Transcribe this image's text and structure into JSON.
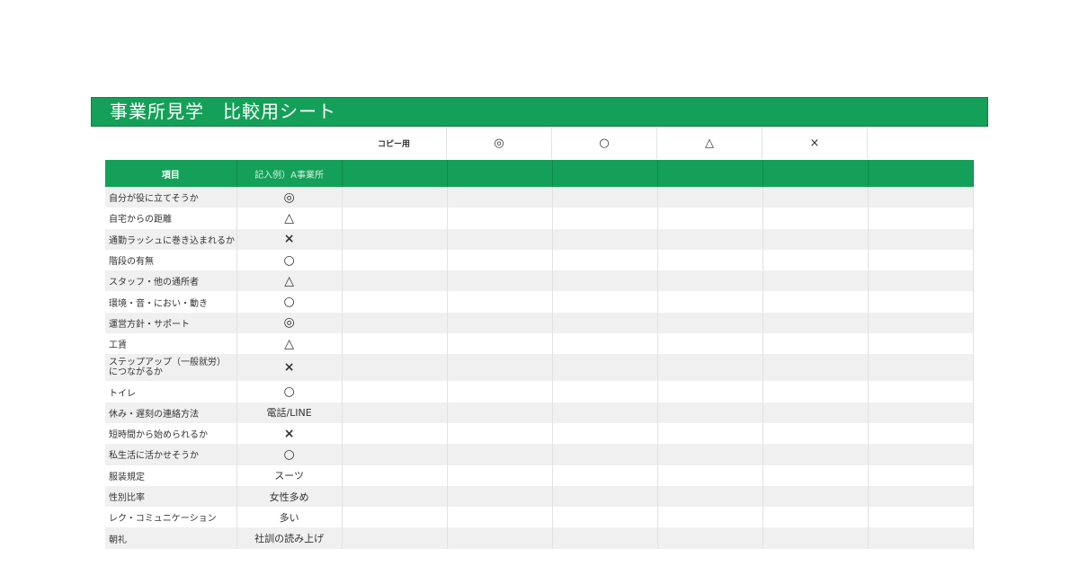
{
  "title": "事業所見学　比較用シート",
  "legend": [
    "コピー用",
    "◎",
    "○",
    "△",
    "×"
  ],
  "table": {
    "headers": [
      "項目",
      "記入例）A事業所",
      "",
      "",
      "",
      "",
      "",
      ""
    ],
    "rows": [
      {
        "item": "自分が役に立てそうか",
        "example": "◎"
      },
      {
        "item": "自宅からの距離",
        "example": "△"
      },
      {
        "item": "通勤ラッシュに巻き込まれるか",
        "example": "×"
      },
      {
        "item": "階段の有無",
        "example": "○"
      },
      {
        "item": "スタッフ・他の通所者",
        "example": "△"
      },
      {
        "item": "環境・音・におい・動き",
        "example": "○"
      },
      {
        "item": "運営方針・サポート",
        "example": "◎"
      },
      {
        "item": "工賃",
        "example": "△"
      },
      {
        "item": "ステップアップ（一般就労）につながるか",
        "example": "×"
      },
      {
        "item": "トイレ",
        "example": "○"
      },
      {
        "item": "休み・遅刻の連絡方法",
        "example": "電話/LINE"
      },
      {
        "item": "短時間から始められるか",
        "example": "×"
      },
      {
        "item": "私生活に活かせそうか",
        "example": "○"
      },
      {
        "item": "服装規定",
        "example": "スーツ"
      },
      {
        "item": "性別比率",
        "example": "女性多め"
      },
      {
        "item": "レク・コミュニケーション",
        "example": "多い"
      },
      {
        "item": "朝礼",
        "example": "社訓の読み上げ"
      }
    ]
  }
}
